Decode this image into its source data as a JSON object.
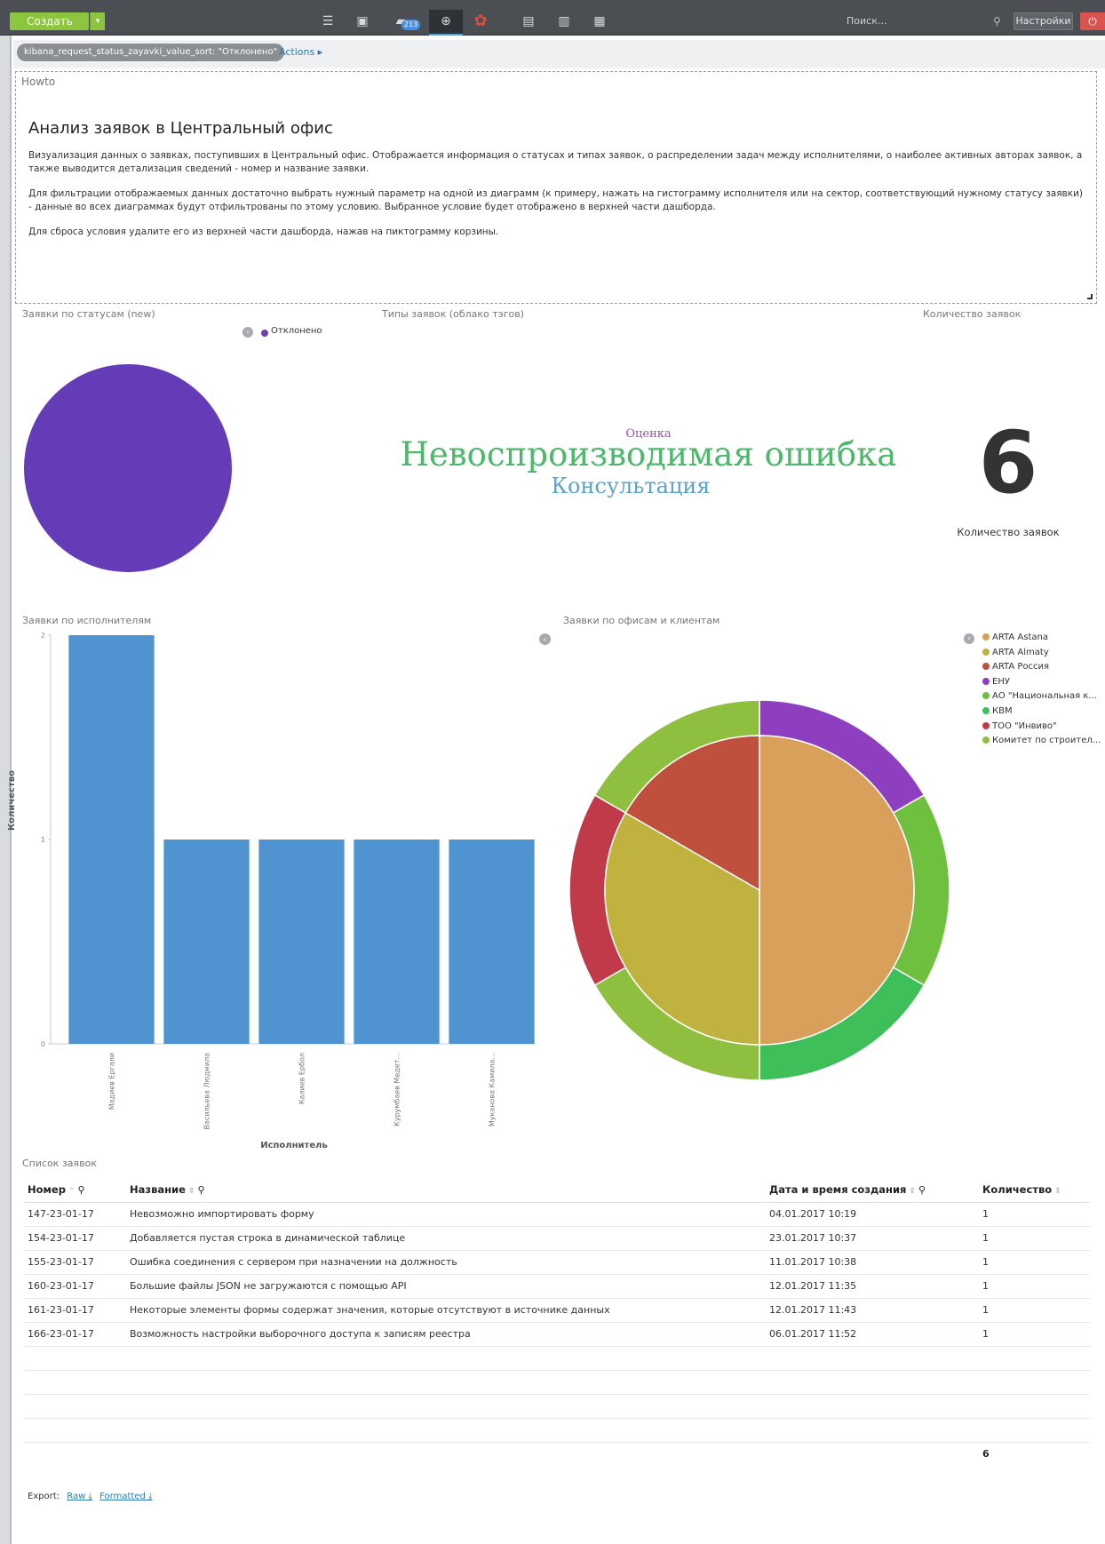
{
  "topbar": {
    "create_label": "Создать",
    "create_caret": "▾",
    "badge": "213",
    "search_placeholder": "Поиск...",
    "settings_label": "Настройки",
    "power_icon": "⏻"
  },
  "filterbar": {
    "filter_text": "kibana_request_status_zayavki_value_sort: \"Отклонено\"",
    "actions_label": "Actions ▸"
  },
  "howto": {
    "label": "Howto",
    "title": "Анализ заявок в Центральный офис",
    "p1": "Визуализация данных о заявках, поступивших в Центральный офис. Отображается информация о статусах и типах заявок, о распределении задач между исполнителями, о наиболее активных авторах заявок, а также выводится детализация сведений - номер и название заявки.",
    "p2": "Для фильтрации отображаемых данных достаточно выбрать нужный параметр на одной из диаграмм (к примеру, нажать на гистограмму исполнителя или на сектор, соответствующий нужному статусу заявки) - данные во всех диаграммах будут отфильтрованы по этому условию. Выбранное условие будет отображено в верхней части дашборда.",
    "p3": "Для сброса условия удалите его из верхней части дашборда, нажав на пиктограмму корзины."
  },
  "panels": {
    "status_title": "Заявки по статусам (new)",
    "tags_title": "Типы заявок (облако тэгов)",
    "count_title": "Количество заявок",
    "executors_title": "Заявки по исполнителям",
    "offices_title": "Заявки по офисам и клиентам",
    "list_title": "Список заявок"
  },
  "status_legend": {
    "label": "Отклонено",
    "color": "#643cb7"
  },
  "tag_cloud": [
    {
      "text": "Оценка",
      "color": "#a34bb3"
    },
    {
      "text": "Невоспроизводимая ошибка",
      "color": "#4cb86a"
    },
    {
      "text": "Консультация",
      "color": "#5aa3c8"
    }
  ],
  "metric": {
    "value": "6",
    "label": "Количество заявок"
  },
  "chart_data": [
    {
      "type": "bar",
      "categories": [
        "Мадиев Ергали",
        "Васильева Людмила",
        "Калиев Ербол",
        "Курумбаев Медет...",
        "Муканова Камила..."
      ],
      "values": [
        2,
        1,
        1,
        1,
        1
      ],
      "xlabel": "Исполнитель",
      "ylabel": "Количество",
      "ylim": [
        0,
        2
      ],
      "yticks": [
        "0",
        "1",
        "2"
      ],
      "color": "#4f94d0"
    },
    {
      "type": "pie",
      "title": "Заявки по офисам и клиентам",
      "inner": {
        "labels": [
          "ARTA Astana",
          "ARTA Almaty",
          "ARTA Россия"
        ],
        "values": [
          3,
          2,
          1
        ],
        "colors": [
          "#d9a05b",
          "#bfb23e",
          "#c0503e"
        ]
      },
      "outer": {
        "labels": [
          "ЕНУ",
          "АО \"Национальная к...",
          "КВМ",
          "ТОО \"Инвиво\"",
          "Комитет по строител..."
        ],
        "values": [
          1,
          1,
          1,
          1,
          1,
          1
        ],
        "colors": [
          "#8e3fbf",
          "#70c040",
          "#3fbf5a",
          "#c13a4a",
          "#8fbf3f"
        ]
      },
      "legend": [
        {
          "label": "ARTA Astana",
          "color": "#d9a05b"
        },
        {
          "label": "ARTA Almaty",
          "color": "#bfb23e"
        },
        {
          "label": "ARTA Россия",
          "color": "#c0503e"
        },
        {
          "label": "ЕНУ",
          "color": "#8e3fbf"
        },
        {
          "label": "АО \"Национальная к...",
          "color": "#70c040"
        },
        {
          "label": "КВМ",
          "color": "#3fbf5a"
        },
        {
          "label": "ТОО \"Инвиво\"",
          "color": "#c13a4a"
        },
        {
          "label": "Комитет по строител...",
          "color": "#8fbf3f"
        }
      ]
    }
  ],
  "table": {
    "headers": [
      "Номер",
      "Название",
      "Дата и время создания",
      "Количество"
    ],
    "rows": [
      [
        "147-23-01-17",
        "Невозможно импортировать форму",
        "04.01.2017 10:19",
        "1"
      ],
      [
        "154-23-01-17",
        "Добавляется пустая строка в динамической таблице",
        "23.01.2017 10:37",
        "1"
      ],
      [
        "155-23-01-17",
        "Ошибка соединения с сервером при назначении на должность",
        "11.01.2017 10:38",
        "1"
      ],
      [
        "160-23-01-17",
        "Большие файлы JSON не загружаются с помощью API",
        "12.01.2017 11:35",
        "1"
      ],
      [
        "161-23-01-17",
        "Некоторые элементы формы содержат значения, которые отсутствуют в источнике данных",
        "12.01.2017 11:43",
        "1"
      ],
      [
        "166-23-01-17",
        "Возможность настройки выборочного доступа к записям реестра",
        "06.01.2017 11:52",
        "1"
      ]
    ],
    "total": "6",
    "export_label": "Export:",
    "export_raw": "Raw ⤓",
    "export_formatted": "Formatted ⤓"
  }
}
